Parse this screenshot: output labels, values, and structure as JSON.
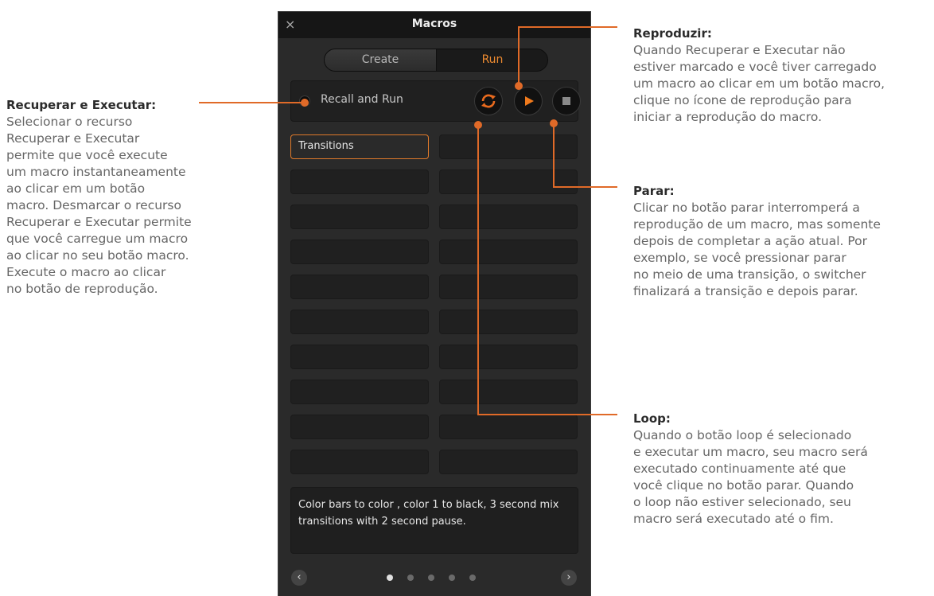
{
  "callouts": {
    "recall": {
      "heading": "Recuperar e Executar:",
      "body": "Selecionar o recurso\nRecuperar e Executar\npermite que você execute\num macro instantaneamente\nao clicar em um botão\nmacro. Desmarcar o recurso\nRecuperar e Executar permite\nque você carregue um macro\nao clicar no seu botão macro.\nExecute o macro ao clicar\nno botão de reprodução."
    },
    "play": {
      "heading": "Reproduzir:",
      "body": "Quando Recuperar e Executar não\nestiver marcado e você tiver carregado\num macro ao clicar em um botão macro,\nclique no ícone de reprodução para\niniciar a reprodução do macro."
    },
    "stop": {
      "heading": "Parar:",
      "body": "Clicar no botão parar interromperá a\nreprodução de um macro, mas somente\ndepois de completar a ação atual. Por\nexemplo, se você pressionar parar\nno meio de uma transição, o switcher\nfinalizará a transição e depois parar."
    },
    "loop": {
      "heading": "Loop:",
      "body": "Quando o botão loop é selecionado\ne executar um macro, seu macro será\nexecutado continuamente até que\nvocê clique no botão parar. Quando\no loop não estiver selecionado, seu\nmacro será executado até o fim."
    }
  },
  "panel": {
    "title": "Macros",
    "close_icon": "×",
    "tabs": [
      "Create",
      "Run"
    ],
    "active_tab": "Run",
    "recall_label": "Recall and Run",
    "buttons": [
      "loop-icon",
      "play-icon",
      "stop-icon"
    ],
    "macros": [
      "Transitions",
      "",
      "",
      "",
      "",
      "",
      "",
      "",
      "",
      "",
      "",
      "",
      "",
      "",
      "",
      "",
      "",
      "",
      "",
      ""
    ],
    "selected_macro": 0,
    "description": "Color bars to color , color 1 to black, 3 second mix transitions with 2 second pause.",
    "prev_icon": "‹",
    "next_icon": "›",
    "pages": 5,
    "current_page": 1
  },
  "colors": {
    "accent": "#e06a28",
    "panel_bg": "#2a2a2a",
    "title_bar": "#161616",
    "run_tab_text": "#ec8a30"
  }
}
